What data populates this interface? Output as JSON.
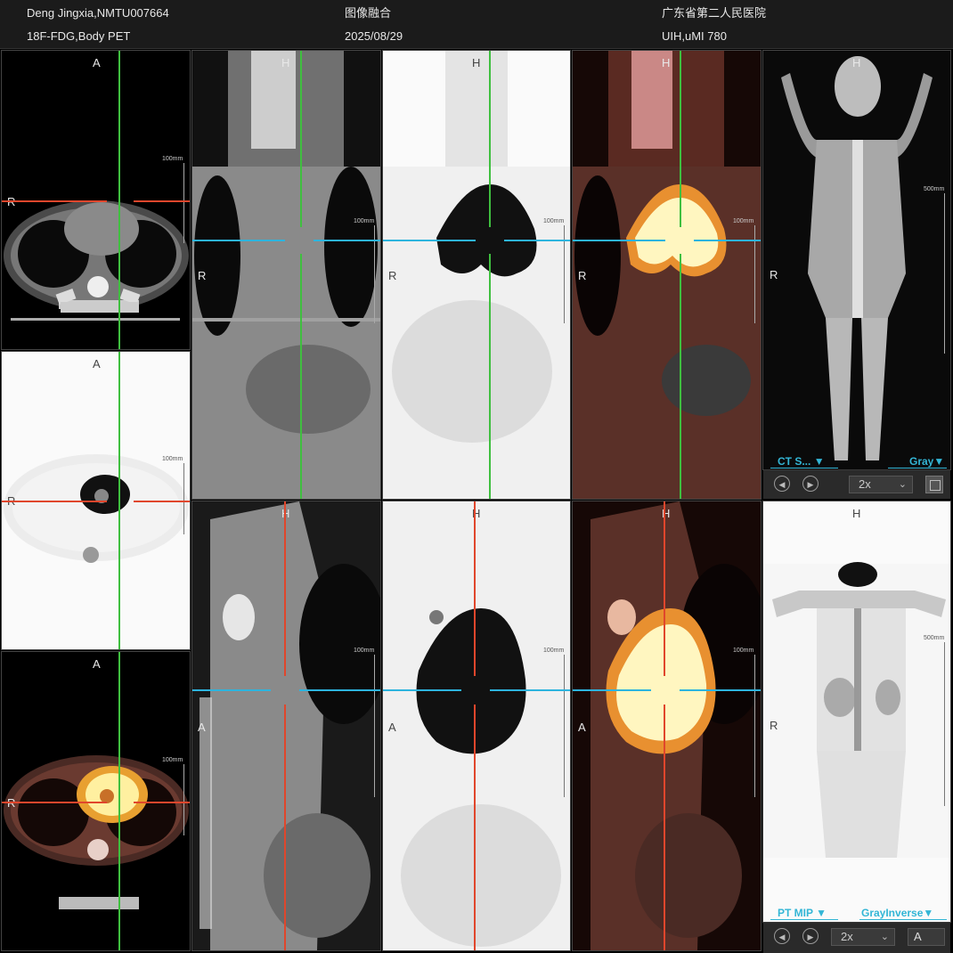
{
  "header": {
    "patient": "Deng Jingxia,NMTU007664",
    "study": "18F-FDG,Body PET",
    "mode": "图像融合",
    "date": "2025/08/29",
    "hospital": "广东省第二人民医院",
    "scanner": "UIH,uMI 780"
  },
  "labels": {
    "anterior": "A",
    "right": "R",
    "head": "H",
    "scale_100": "100mm",
    "scale_500": "500mm"
  },
  "panels": {
    "mip_ct": {
      "series": "CT S...",
      "lut": "Gray",
      "zoom": "2x"
    },
    "mip_pt": {
      "series": "PT MIP",
      "lut": "GrayInverse",
      "zoom": "2x",
      "orientation_value": "A"
    }
  },
  "colors": {
    "crosshair_green": "#3fbf3f",
    "crosshair_red": "#e0462c",
    "crosshair_blue": "#2db4de",
    "accent": "#33b6d6"
  },
  "icons": {
    "prev": "chevron-left-icon",
    "next": "chevron-right-icon",
    "save": "save-icon"
  }
}
